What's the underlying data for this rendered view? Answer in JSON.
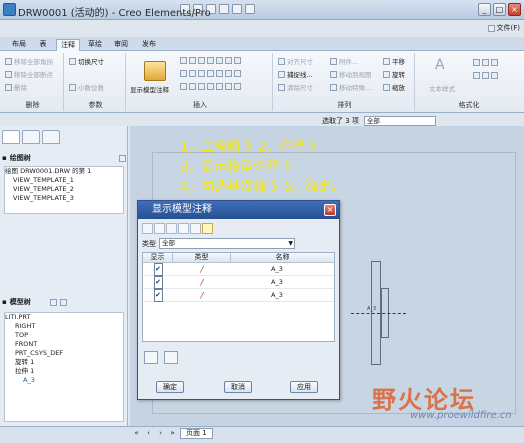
{
  "window": {
    "title": "DRW0001 (活动的) - Creo Elements/Pro",
    "buttons": [
      "_",
      "□",
      "×"
    ]
  },
  "help": {
    "file_label": "文件(F)"
  },
  "ribbon_tabs": [
    "布局",
    "表",
    "注释",
    "草绘",
    "审阅",
    "发布"
  ],
  "ribbon": {
    "delete_group": {
      "label": "删除",
      "items": [
        "移除全部角拐",
        "移除全部断点",
        "删除"
      ]
    },
    "params_group": {
      "label": "参数",
      "items": [
        "切换尺寸",
        "小数位数"
      ]
    },
    "insert_group": {
      "label": "插入",
      "big_button": "显示模型注释"
    },
    "arrange_group": {
      "label": "排列",
      "items": [
        "对齐尺寸",
        "附件...",
        "捕捉线...",
        "移动到视图",
        "清除尺寸",
        "移动特殊...",
        "平移",
        "旋转",
        "缩放"
      ]
    },
    "format_group": {
      "label": "格式化",
      "items": [
        "文本样式"
      ]
    }
  },
  "selection": {
    "count_text": "选取了 3 项",
    "filter_value": "全部"
  },
  "left_panel": {
    "drawing_tree_title": "绘图树",
    "drawing_tree_items": [
      "绘图 DRW0001.DRW 的第 1",
      "VIEW_TEMPLATE_1",
      "VIEW_TEMPLATE_2",
      "VIEW_TEMPLATE_3"
    ],
    "model_tree_title": "模型树",
    "model_tree_items": [
      "LITI.PRT",
      "RIGHT",
      "TOP",
      "FRONT",
      "PRT_CSYS_DEF",
      "旋转 1",
      "拉伸 1",
      "A_3"
    ]
  },
  "annotations": {
    "line1": "1，工程图-》2，注释-》",
    "line2": "3，显示模型注释-》",
    "line3": "4，勾选基准轴-》5，确定。"
  },
  "dialog": {
    "title": "显示模型注释",
    "type_label": "类型",
    "type_value": "全部",
    "columns": [
      "显示",
      "类型",
      "名称"
    ],
    "rows": [
      {
        "checked": "✔",
        "name": "A_3"
      },
      {
        "checked": "✔",
        "name": "A_3"
      },
      {
        "checked": "✔",
        "name": "A_3"
      }
    ],
    "ok_label": "确定",
    "cancel_label": "取消",
    "apply_label": "应用"
  },
  "canvas": {
    "axis_label": "A_3"
  },
  "page_tab": "页面 1",
  "watermark": {
    "text": "野火论坛",
    "url": "www.proewildfire.cn"
  },
  "colors": {
    "annotation_yellow": "#f2e514",
    "dialog_title_blue": "#264f93",
    "watermark_orange": "#d9734a"
  }
}
